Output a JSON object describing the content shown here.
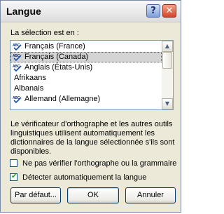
{
  "window": {
    "title": "Langue",
    "help_glyph": "?",
    "close_glyph": "✕"
  },
  "selection_label": "La sélection est en :",
  "languages": [
    {
      "label": "Français (France)",
      "spell_check": true,
      "selected": false
    },
    {
      "label": "Français (Canada)",
      "spell_check": true,
      "selected": true
    },
    {
      "label": "Anglais (États-Unis)",
      "spell_check": true,
      "selected": false
    },
    {
      "label": "Afrikaans",
      "spell_check": false,
      "selected": false
    },
    {
      "label": "Albanais",
      "spell_check": false,
      "selected": false
    },
    {
      "label": "Allemand (Allemagne)",
      "spell_check": true,
      "selected": false
    }
  ],
  "spell_icon_text": "ABC",
  "description": "Le vérificateur d'orthographe et les autres outils linguistiques utilisent automatiquement les dictionnaires de la langue sélectionnée s'ils sont disponibles.",
  "checkboxes": {
    "no_check": {
      "label": "Ne pas vérifier l'orthographe ou la grammaire",
      "checked": false
    },
    "auto_detect": {
      "label": "Détecter automatiquement la langue",
      "checked": true
    }
  },
  "buttons": {
    "default": "Par défaut...",
    "ok": "OK",
    "cancel": "Annuler"
  },
  "scroll_arrows": {
    "up": "▲",
    "down": "▼"
  }
}
